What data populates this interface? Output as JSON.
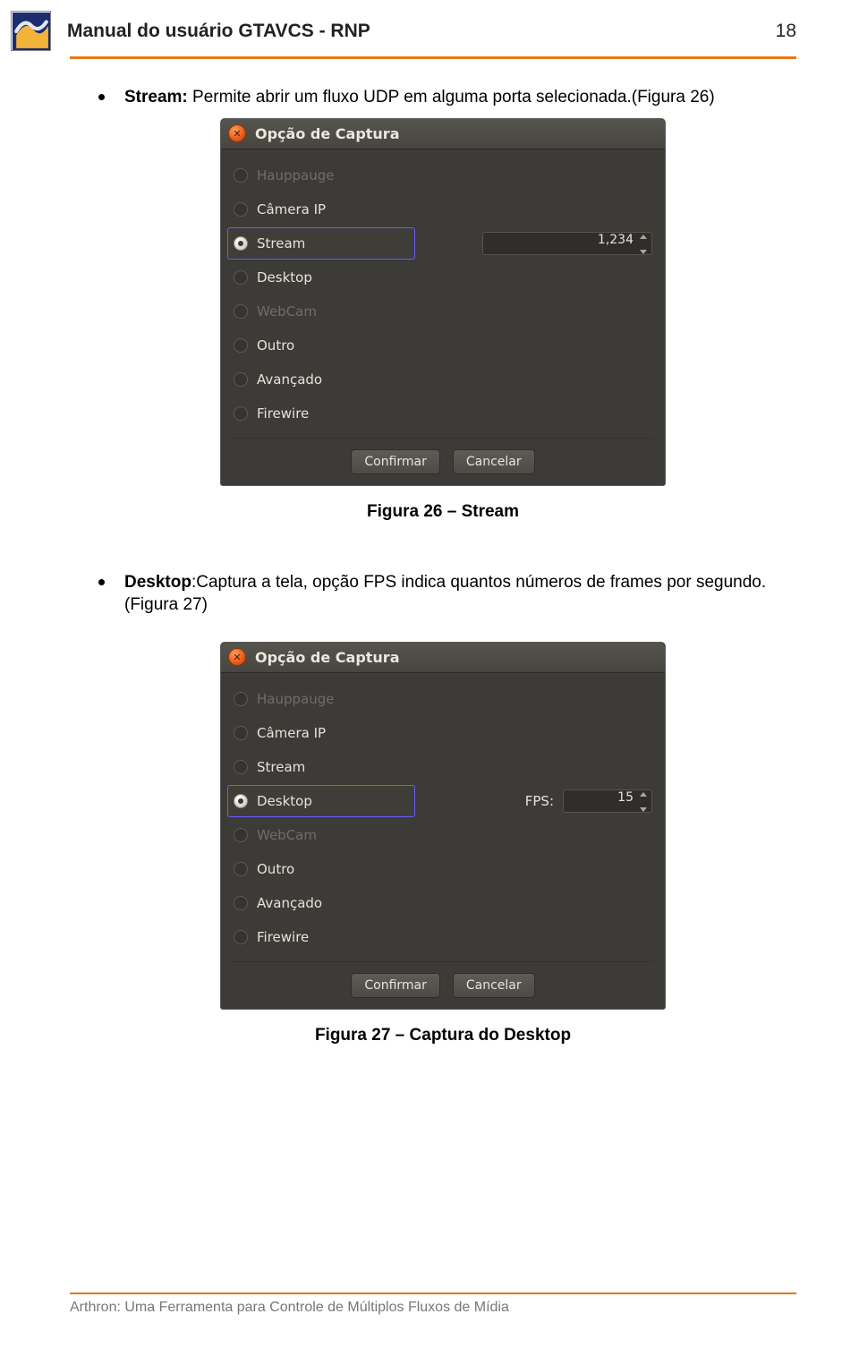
{
  "header": {
    "title": "Manual do usuário GTAVCS - RNP",
    "page_number": "18"
  },
  "section1": {
    "bullet_bold": "Stream: ",
    "bullet_rest": "Permite abrir um fluxo UDP em alguma porta selecionada.(Figura 26)",
    "caption": "Figura 26 – Stream"
  },
  "section2": {
    "bullet_bold": "Desktop",
    "bullet_rest": ":Captura a tela, opção FPS indica quantos números de frames por segundo.(Figura 27)",
    "caption": "Figura 27 – Captura do Desktop"
  },
  "dialog_common": {
    "title": "Opção de Captura",
    "options": {
      "hauppauge": "Hauppauge",
      "cameraip": "Câmera IP",
      "stream": "Stream",
      "desktop": "Desktop",
      "webcam": "WebCam",
      "outro": "Outro",
      "avancado": "Avançado",
      "firewire": "Firewire"
    },
    "confirm": "Confirmar",
    "cancel": "Cancelar"
  },
  "dialog1": {
    "selected": "stream",
    "port_value": "1,234"
  },
  "dialog2": {
    "selected": "desktop",
    "fps_label": "FPS:",
    "fps_value": "15"
  },
  "footer": "Arthron: Uma Ferramenta para Controle de Múltiplos Fluxos de Mídia"
}
